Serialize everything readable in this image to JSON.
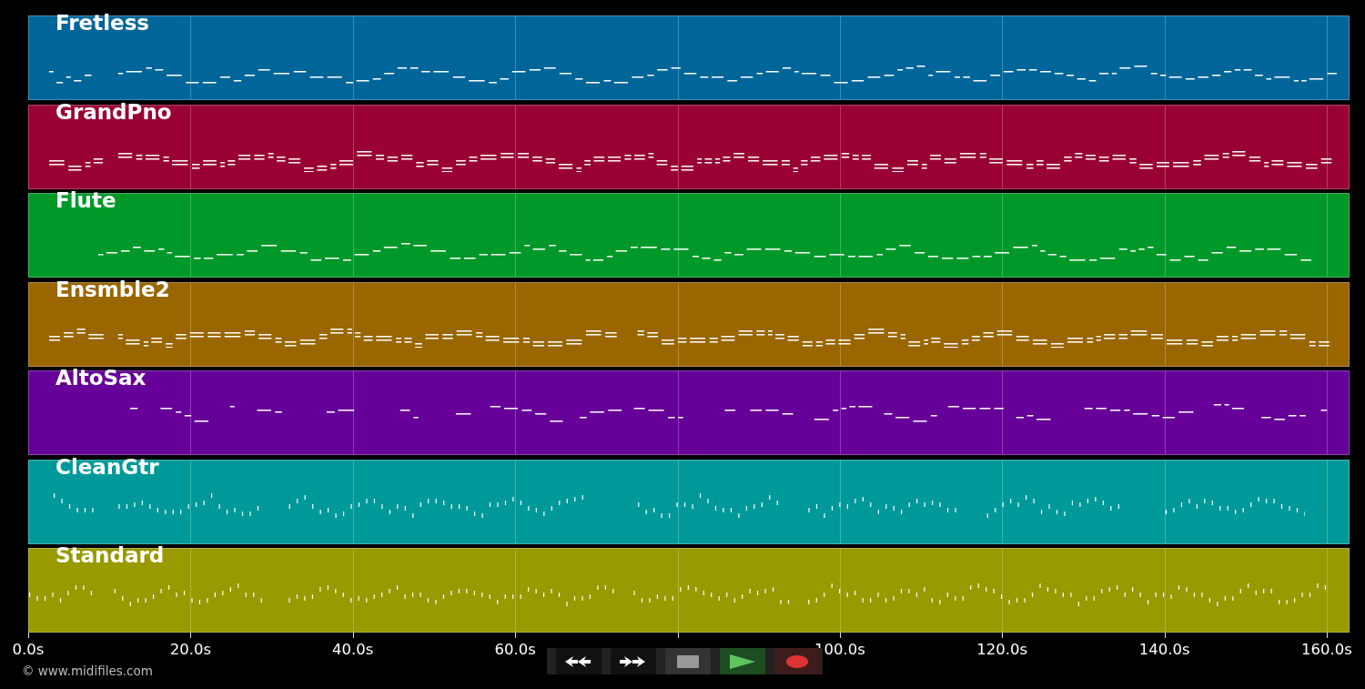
{
  "tracks": [
    {
      "name": "Fretless",
      "color": "#006699",
      "kind": "line"
    },
    {
      "name": "GrandPno",
      "color": "#990033",
      "kind": "chord"
    },
    {
      "name": "Flute",
      "color": "#009929",
      "kind": "line"
    },
    {
      "name": "Ensmble2",
      "color": "#996600",
      "kind": "chord"
    },
    {
      "name": "AltoSax",
      "color": "#660099",
      "kind": "phrase"
    },
    {
      "name": "CleanGtr",
      "color": "#009999",
      "kind": "dots"
    },
    {
      "name": "Standard",
      "color": "#999900",
      "kind": "dots"
    }
  ],
  "axis": {
    "ticks": [
      "0.0s",
      "20.0s",
      "40.0s",
      "60.0s",
      "100.0s",
      "120.0s",
      "140.0s",
      "160.0s"
    ]
  },
  "footer": {
    "copyright": "© www.midifiles.com"
  }
}
